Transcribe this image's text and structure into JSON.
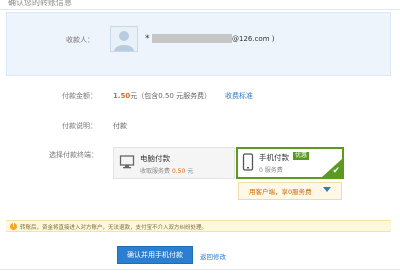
{
  "header": {
    "title": "确认您的转账信息"
  },
  "recipient": {
    "label": "收款人：",
    "email_prefix": "*",
    "email_suffix": "@126.com )"
  },
  "amount": {
    "label": "付款金额：",
    "value": "1.50",
    "detail": "元（包含0.50 元服务费）",
    "fee_link": "收费标准"
  },
  "description": {
    "label": "付款说明：",
    "value": "付款"
  },
  "payment_method": {
    "label": "选择付款终端：",
    "options": [
      {
        "title": "电脑付款",
        "sub_prefix": "收取服务费",
        "fee": "0.50",
        "sub_suffix": "元",
        "selected": false
      },
      {
        "title": "手机付款",
        "badge": "优惠",
        "sub": "0 服务费",
        "selected": true
      }
    ],
    "tip": "用客户端，享0服务费"
  },
  "notice": {
    "icon": "!",
    "text": "转账后，资金将直接进入对方账户，无法退款，支付宝不介入双方纠纷处理。"
  },
  "actions": {
    "confirm": "确认并用手机付款",
    "back": "返回修改"
  },
  "colors": {
    "primary_blue": "#2a7fd0",
    "link_blue": "#2f7dc7",
    "accent_green": "#5a9a1f",
    "amount_orange": "#e06a18"
  }
}
